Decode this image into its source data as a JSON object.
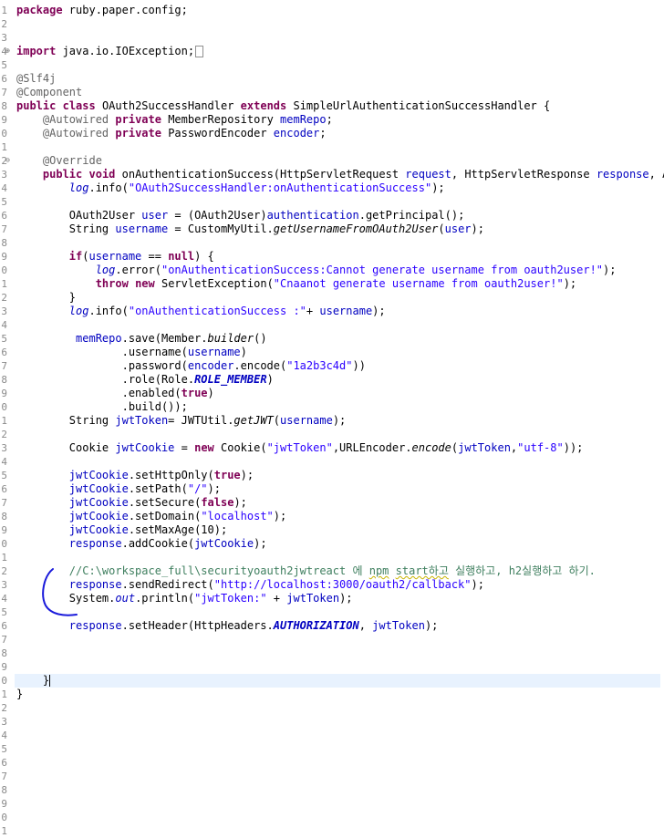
{
  "editor": {
    "line_numbers": [
      "1",
      "2",
      "3",
      "4",
      "5",
      "6",
      "7",
      "8",
      "9",
      "0",
      "1",
      "2",
      "3",
      "4",
      "5",
      "6",
      "7",
      "8",
      "9",
      "0",
      "1",
      "2",
      "3",
      "4",
      "5",
      "6",
      "7",
      "8",
      "9",
      "0",
      "1",
      "2",
      "3",
      "4",
      "5",
      "6",
      "7",
      "8",
      "9",
      "0",
      "1",
      "2",
      "3",
      "4",
      "5",
      "6",
      "7",
      "8",
      "9",
      "0",
      "1",
      "2",
      "3",
      "4",
      "5",
      "6",
      "7",
      "8",
      "9",
      "0",
      "1"
    ],
    "fold_markers": {
      "l4": "⊕",
      "l12": "⊖"
    },
    "lines": {
      "l1": {
        "a": "package",
        "b": " ruby.paper.config;"
      },
      "l4": {
        "a": "import",
        "b": " java.io.IOException;"
      },
      "l6": {
        "a": "@Slf4j"
      },
      "l7": {
        "a": "@Component"
      },
      "l8": {
        "a": "public",
        "b": " ",
        "c": "class",
        "d": " OAuth2SuccessHandler ",
        "e": "extends",
        "f": " SimpleUrlAuthenticationSuccessHandler {"
      },
      "l9": {
        "a": "    ",
        "b": "@Autowired",
        "c": " ",
        "d": "private",
        "e": " MemberRepository ",
        "f": "memRepo",
        "g": ";"
      },
      "l10": {
        "a": "    ",
        "b": "@Autowired",
        "c": " ",
        "d": "private",
        "e": " PasswordEncoder ",
        "f": "encoder",
        "g": ";"
      },
      "l12": {
        "a": "    ",
        "b": "@Override"
      },
      "l13": {
        "a": "    ",
        "b": "public",
        "c": " ",
        "d": "void",
        "e": " onAuthenticationSuccess(HttpServletRequest ",
        "f": "request",
        "g": ", HttpServletResponse ",
        "h": "response",
        "i": ", Aut"
      },
      "l14": {
        "a": "        ",
        "b": "log",
        "c": ".info(",
        "d": "\"OAuth2SuccessHandler:onAuthenticationSuccess\"",
        "e": ");"
      },
      "l16": {
        "a": "        OAuth2User ",
        "b": "user",
        "c": " = (OAuth2User)",
        "d": "authentication",
        "e": ".getPrincipal();"
      },
      "l17": {
        "a": "        String ",
        "b": "username",
        "c": " = CustomMyUtil.",
        "d": "getUsernameFromOAuth2User",
        "e": "(",
        "f": "user",
        "g": ");"
      },
      "l19": {
        "a": "        ",
        "b": "if",
        "c": "(",
        "d": "username",
        "e": " == ",
        "f": "null",
        "g": ") {"
      },
      "l20": {
        "a": "            ",
        "b": "log",
        "c": ".error(",
        "d": "\"onAuthenticationSuccess:Cannot generate username from oauth2user!\"",
        "e": ");"
      },
      "l21": {
        "a": "            ",
        "b": "throw",
        "c": " ",
        "d": "new",
        "e": " ServletException(",
        "f": "\"Cnaanot generate username from oauth2user!\"",
        "g": ");"
      },
      "l22": {
        "a": "        }"
      },
      "l23": {
        "a": "        ",
        "b": "log",
        "c": ".info(",
        "d": "\"onAuthenticationSuccess :\"",
        "e": "+ ",
        "f": "username",
        "g": ");"
      },
      "l25": {
        "a": "         ",
        "b": "memRepo",
        "c": ".save(Member.",
        "d": "builder",
        "e": "()"
      },
      "l26": {
        "a": "                .username(",
        "b": "username",
        "c": ")"
      },
      "l27": {
        "a": "                .password(",
        "b": "encoder",
        "c": ".encode(",
        "d": "\"1a2b3c4d\"",
        "e": "))"
      },
      "l28": {
        "a": "                .role(Role.",
        "b": "ROLE_MEMBER",
        "c": ")"
      },
      "l29": {
        "a": "                .enabled(",
        "b": "true",
        "c": ")"
      },
      "l30": {
        "a": "                .build());"
      },
      "l31": {
        "a": "        String ",
        "b": "jwtToken",
        "c": "= JWTUtil.",
        "d": "getJWT",
        "e": "(",
        "f": "username",
        "g": ");"
      },
      "l33": {
        "a": "        Cookie ",
        "b": "jwtCookie",
        "c": " = ",
        "d": "new",
        "e": " Cookie(",
        "f": "\"jwtToken\"",
        "g": ",URLEncoder.",
        "h": "encode",
        "i": "(",
        "j": "jwtToken",
        "k": ",",
        "l": "\"utf-8\"",
        "m": "));"
      },
      "l35": {
        "a": "        ",
        "b": "jwtCookie",
        "c": ".setHttpOnly(",
        "d": "true",
        "e": ");"
      },
      "l36": {
        "a": "        ",
        "b": "jwtCookie",
        "c": ".setPath(",
        "d": "\"/\"",
        "e": ");"
      },
      "l37": {
        "a": "        ",
        "b": "jwtCookie",
        "c": ".setSecure(",
        "d": "false",
        "e": ");"
      },
      "l38": {
        "a": "        ",
        "b": "jwtCookie",
        "c": ".setDomain(",
        "d": "\"localhost\"",
        "e": ");"
      },
      "l39": {
        "a": "        ",
        "b": "jwtCookie",
        "c": ".setMaxAge(10);"
      },
      "l40": {
        "a": "        ",
        "b": "response",
        "c": ".addCookie(",
        "d": "jwtCookie",
        "e": ");"
      },
      "l42": {
        "a": "        ",
        "b": "//C:\\workspace_full\\securityoauth2jwtreact 에 ",
        "c": "npm",
        "d": " ",
        "e": "start하고",
        "f": " 실행하고, h2실행하고 하기."
      },
      "l43": {
        "a": "        ",
        "b": "response",
        "c": ".sendRedirect(",
        "d": "\"http://localhost:3000/oauth2/callback\"",
        "e": ");"
      },
      "l44": {
        "a": "        System.",
        "b": "out",
        "c": ".println(",
        "d": "\"jwtToken:\"",
        "e": " + ",
        "f": "jwtToken",
        "g": ");"
      },
      "l46": {
        "a": "        ",
        "b": "response",
        "c": ".setHeader(HttpHeaders.",
        "d": "AUTHORIZATION",
        "e": ", ",
        "f": "jwtToken",
        "g": ");"
      },
      "l50": {
        "a": "    }"
      },
      "l51": {
        "a": "}"
      }
    }
  },
  "colors": {
    "keyword": "#7f0055",
    "string": "#2a00ff",
    "field": "#0000c0",
    "annotation": "#646464",
    "comment": "#3f7f5f",
    "current_line": "#e8f2fe",
    "pen_annotation": "#1a1adb"
  }
}
